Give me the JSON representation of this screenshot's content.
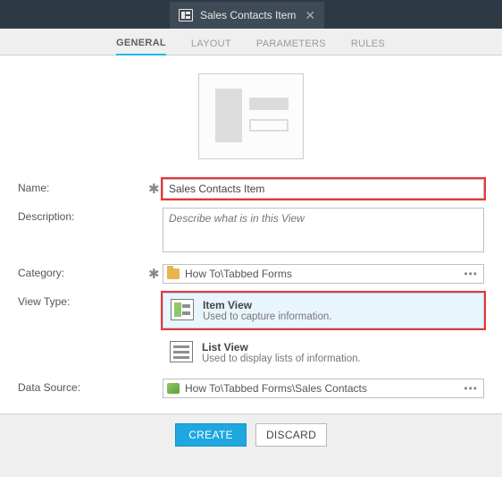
{
  "window": {
    "title": "Sales Contacts Item"
  },
  "tabs": {
    "general": "GENERAL",
    "layout": "LAYOUT",
    "parameters": "PARAMETERS",
    "rules": "RULES"
  },
  "form": {
    "name_label": "Name:",
    "name_value": "Sales Contacts Item",
    "description_label": "Description:",
    "description_placeholder": "Describe what is in this View",
    "category_label": "Category:",
    "category_value": "How To\\Tabbed Forms",
    "view_type_label": "View Type:",
    "data_source_label": "Data Source:",
    "data_source_value": "How To\\Tabbed Forms\\Sales Contacts"
  },
  "view_types": {
    "item": {
      "title": "Item View",
      "desc": "Used to capture information."
    },
    "list": {
      "title": "List View",
      "desc": "Used to display lists of information."
    }
  },
  "buttons": {
    "create": "CREATE",
    "discard": "DISCARD"
  }
}
